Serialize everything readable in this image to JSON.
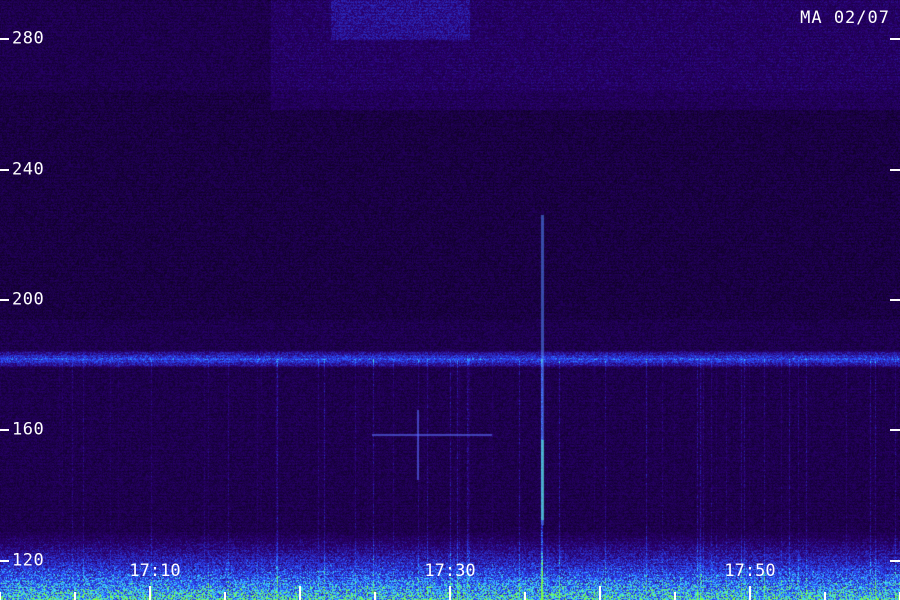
{
  "chart_data": {
    "type": "heatmap",
    "title": "MA 02/07",
    "x_tick_labels": [
      "17:10",
      "17:30",
      "17:50"
    ],
    "y_ticks": [
      120,
      160,
      200,
      240,
      280
    ],
    "ylim": [
      108,
      292
    ],
    "colors": {
      "background_low": "#0a0018",
      "background_mid": "#2a0070",
      "band": "#2a4cff",
      "hot": "#3fe0ff",
      "noise_floor": "#7dff3a"
    }
  }
}
